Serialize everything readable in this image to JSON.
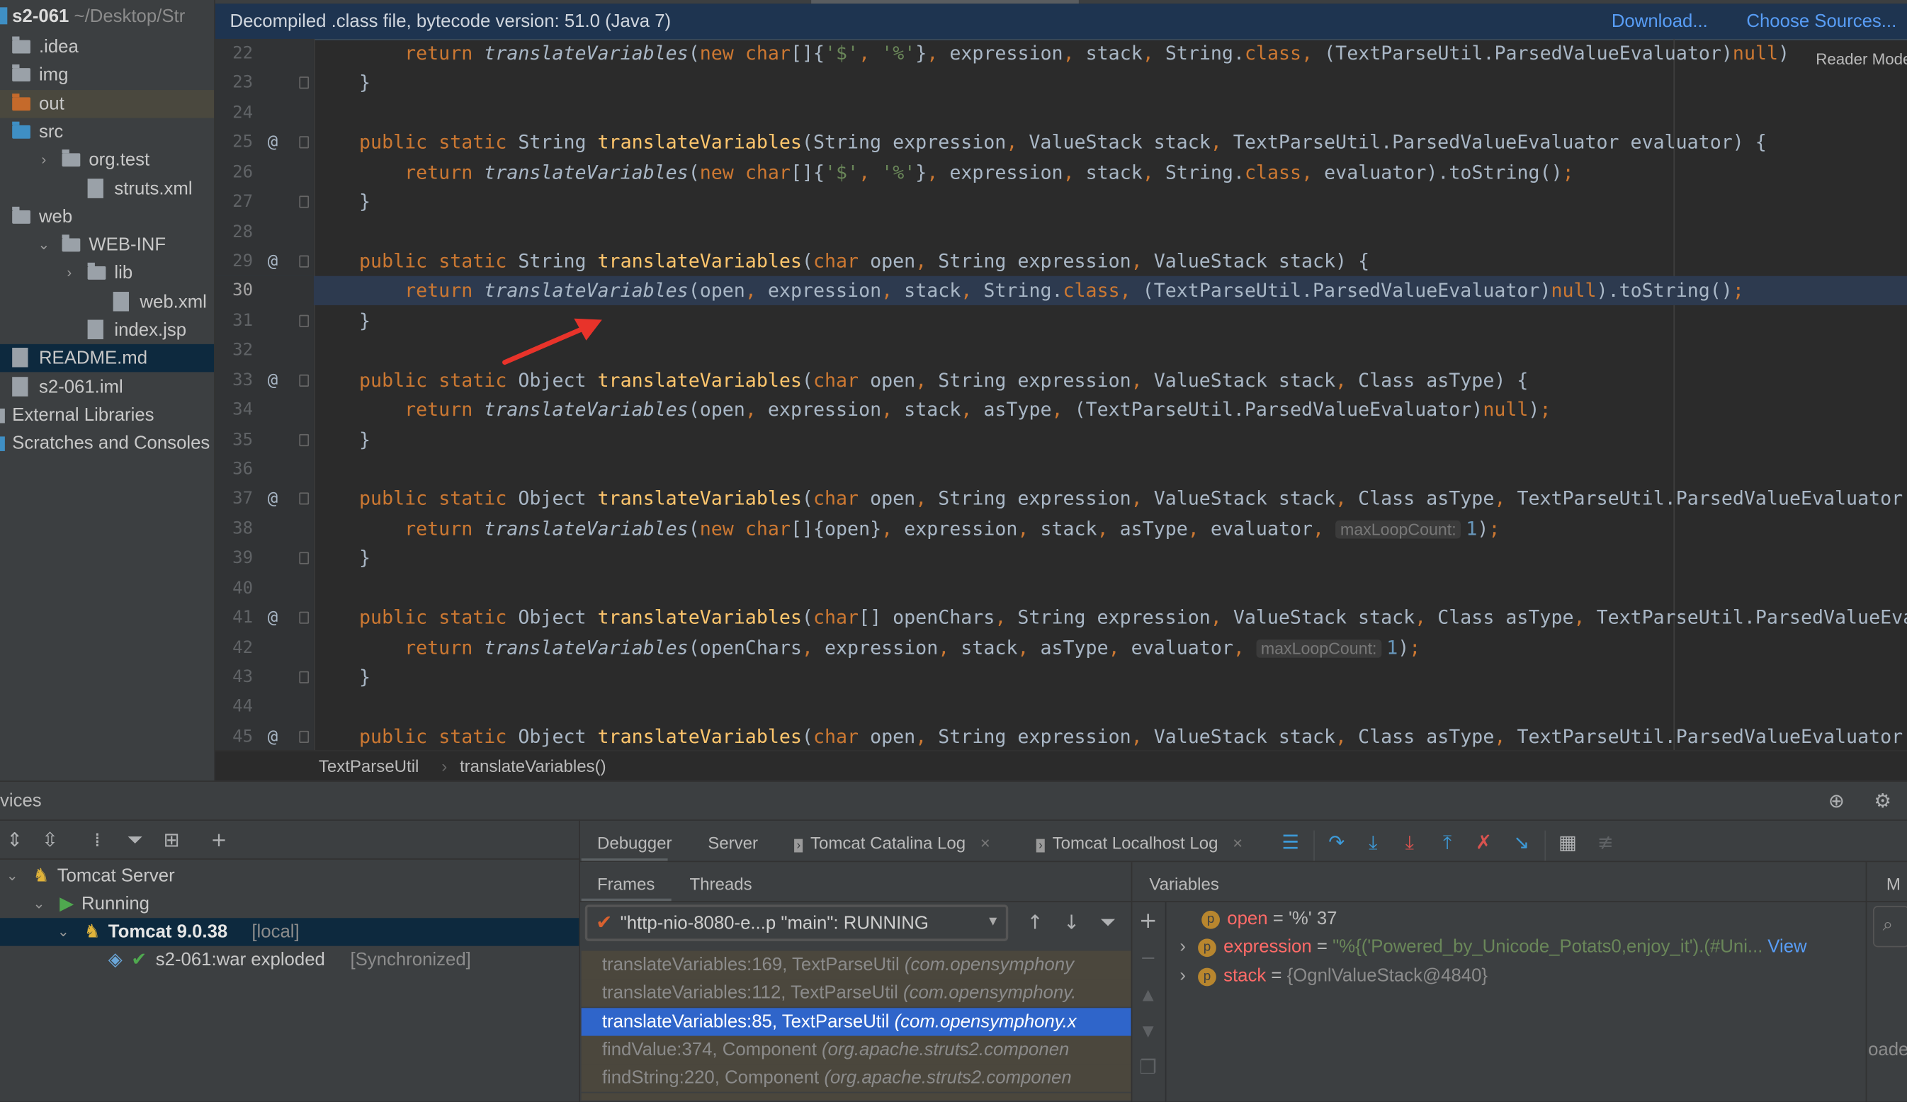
{
  "project": {
    "name": "s2-061",
    "path": "~/Desktop/Str",
    "tree": [
      {
        "label": ".idea",
        "icon": "folder-icon",
        "color": "#9aa1a8",
        "indent": 0,
        "chevron": ""
      },
      {
        "label": "img",
        "icon": "folder-icon",
        "color": "#9aa1a8",
        "indent": 0,
        "chevron": ""
      },
      {
        "label": "out",
        "icon": "folder-icon",
        "color": "#c56a2b",
        "indent": 0,
        "chevron": "",
        "state": "hl"
      },
      {
        "label": "src",
        "icon": "folder-icon",
        "color": "#3f8fc4",
        "indent": 0,
        "chevron": ""
      },
      {
        "label": "org.test",
        "icon": "package-icon",
        "color": "#9aa1a8",
        "indent": 1,
        "chevron": "›"
      },
      {
        "label": "struts.xml",
        "icon": "xml-file-icon",
        "color": "#9aa1a8",
        "indent": 2,
        "chevron": ""
      },
      {
        "label": "web",
        "icon": "web-folder-icon",
        "color": "#9aa1a8",
        "indent": 0,
        "chevron": ""
      },
      {
        "label": "WEB-INF",
        "icon": "folder-icon",
        "color": "#9aa1a8",
        "indent": 1,
        "chevron": "⌄"
      },
      {
        "label": "lib",
        "icon": "folder-icon",
        "color": "#9aa1a8",
        "indent": 2,
        "chevron": "›"
      },
      {
        "label": "web.xml",
        "icon": "xml-file-icon",
        "color": "#9aa1a8",
        "indent": 3,
        "chevron": ""
      },
      {
        "label": "index.jsp",
        "icon": "jsp-file-icon",
        "color": "#9aa1a8",
        "indent": 2,
        "chevron": ""
      },
      {
        "label": "README.md",
        "icon": "markdown-file-icon",
        "color": "#9aa1a8",
        "indent": 0,
        "chevron": "",
        "state": "sel"
      },
      {
        "label": "s2-061.iml",
        "icon": "iml-file-icon",
        "color": "#9aa1a8",
        "indent": 0,
        "chevron": ""
      },
      {
        "label": "External Libraries",
        "icon": "library-icon",
        "color": "#9aa1a8",
        "indent": -1,
        "chevron": ""
      },
      {
        "label": "Scratches and Consoles",
        "icon": "scratches-icon",
        "color": "#3f8fc4",
        "indent": -1,
        "chevron": ""
      }
    ]
  },
  "editor": {
    "banner": "Decompiled .class file, bytecode version: 51.0 (Java 7)",
    "download": "Download...",
    "choose_sources": "Choose Sources...",
    "reader_mode": "Reader Mode",
    "current_line": 30,
    "lines": [
      {
        "n": 22,
        "code": "        return translateVariables(new char[]{'$', '%'}, expression, stack, String.class, (TextParseUtil.ParsedValueEvaluator)null)"
      },
      {
        "n": 23,
        "code": "    }",
        "fold": true
      },
      {
        "n": 24,
        "code": ""
      },
      {
        "n": 25,
        "code": "    public static String translateVariables(String expression, ValueStack stack, TextParseUtil.ParsedValueEvaluator evaluator) {",
        "at": "@",
        "fold": true
      },
      {
        "n": 26,
        "code": "        return translateVariables(new char[]{'$', '%'}, expression, stack, String.class, evaluator).toString();"
      },
      {
        "n": 27,
        "code": "    }",
        "fold": true
      },
      {
        "n": 28,
        "code": ""
      },
      {
        "n": 29,
        "code": "    public static String translateVariables(char open, String expression, ValueStack stack) {",
        "at": "@",
        "fold": true
      },
      {
        "n": 30,
        "code": "        return translateVariables(open, expression, stack, String.class, (TextParseUtil.ParsedValueEvaluator)null).toString();"
      },
      {
        "n": 31,
        "code": "    }",
        "fold": true
      },
      {
        "n": 32,
        "code": ""
      },
      {
        "n": 33,
        "code": "    public static Object translateVariables(char open, String expression, ValueStack stack, Class asType) {",
        "at": "@",
        "fold": true
      },
      {
        "n": 34,
        "code": "        return translateVariables(open, expression, stack, asType, (TextParseUtil.ParsedValueEvaluator)null);"
      },
      {
        "n": 35,
        "code": "    }",
        "fold": true
      },
      {
        "n": 36,
        "code": ""
      },
      {
        "n": 37,
        "code": "    public static Object translateVariables(char open, String expression, ValueStack stack, Class asType, TextParseUtil.ParsedValueEvaluator",
        "at": "@",
        "fold": true
      },
      {
        "n": 38,
        "code": "        return translateVariables(new char[]{open}, expression, stack, asType, evaluator, ",
        "hint": "maxLoopCount:",
        "after": "1);"
      },
      {
        "n": 39,
        "code": "    }",
        "fold": true
      },
      {
        "n": 40,
        "code": ""
      },
      {
        "n": 41,
        "code": "    public static Object translateVariables(char[] openChars, String expression, ValueStack stack, Class asType, TextParseUtil.ParsedValueEva",
        "at": "@",
        "fold": true
      },
      {
        "n": 42,
        "code": "        return translateVariables(openChars, expression, stack, asType, evaluator, ",
        "hint": "maxLoopCount:",
        "after": "1);"
      },
      {
        "n": 43,
        "code": "    }",
        "fold": true
      },
      {
        "n": 44,
        "code": ""
      },
      {
        "n": 45,
        "code": "    public static Object translateVariables(char open, String expression, ValueStack stack, Class asType, TextParseUtil.ParsedValueEvaluator",
        "at": "@",
        "fold": true
      }
    ],
    "breadcrumb": [
      "TextParseUtil",
      "translateVariables()"
    ],
    "breadcrumb_sep": "›",
    "annotation_arrow_color": "#e8332a"
  },
  "services": {
    "title": "vices",
    "tree": [
      {
        "label": "Tomcat Server",
        "suffix": "",
        "icon": "tomcat-icon"
      },
      {
        "label": "Running",
        "suffix": "",
        "icon": "run-icon"
      },
      {
        "label": "Tomcat 9.0.38",
        "suffix": "[local]",
        "icon": "tomcat-icon"
      },
      {
        "label": "s2-061:war exploded",
        "suffix": "[Synchronized]",
        "icon": "artifact-icon"
      }
    ]
  },
  "debugger": {
    "tabs": [
      "Debugger",
      "Server",
      "Tomcat Catalina Log",
      "Tomcat Localhost Log"
    ],
    "subtabs": [
      "Frames",
      "Threads"
    ],
    "thread": "\"http-nio-8080-e...p \"main\": RUNNING",
    "frames": [
      {
        "method": "translateVariables:169, TextParseUtil",
        "pkg": "(com.opensymphony"
      },
      {
        "method": "translateVariables:112, TextParseUtil",
        "pkg": "(com.opensymphony."
      },
      {
        "method": "translateVariables:85, TextParseUtil",
        "pkg": "(com.opensymphony.x",
        "selected": true
      },
      {
        "method": "findValue:374, Component",
        "pkg": "(org.apache.struts2.componen"
      },
      {
        "method": "findString:220, Component",
        "pkg": "(org.apache.struts2.componen"
      }
    ],
    "variables_title": "Variables",
    "variables": [
      {
        "name": "open",
        "value": "'%' 37",
        "kind": "plain",
        "expandable": false
      },
      {
        "name": "expression",
        "value": "\"%{('Powered_by_Unicode_Potats0,enjoy_it').(#Uni...",
        "kind": "str",
        "expandable": true,
        "link": "View"
      },
      {
        "name": "stack",
        "value": "{OgnlValueStack@4840}",
        "kind": "obj",
        "expandable": true
      }
    ],
    "right_panel_label": "M",
    "right_panel_fragment": "oade"
  }
}
